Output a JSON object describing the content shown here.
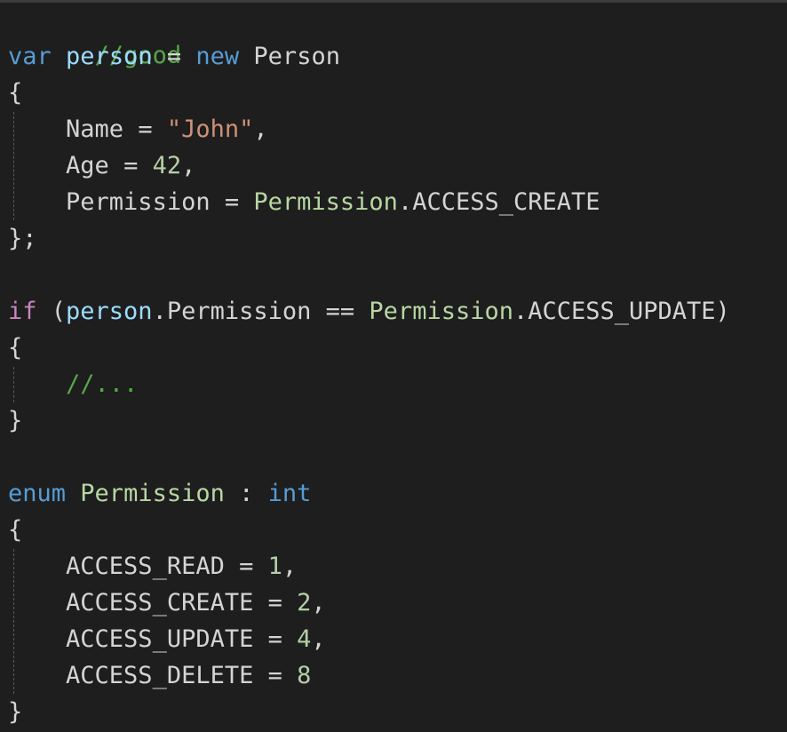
{
  "colors": {
    "background": "#1e1e1e",
    "keyword": "#569cd6",
    "control_keyword": "#c586c0",
    "variable": "#9cdcfe",
    "type": "#b8d7a3",
    "string": "#ce9178",
    "number": "#b5cea8",
    "comment": "#57a64a",
    "text": "#d4d4d4"
  },
  "code": {
    "l1": {
      "comment": "//good"
    },
    "l2": {
      "kw_var": "var",
      "name": "person",
      "op": " = ",
      "kw_new": "new",
      "type": "Person"
    },
    "l3": {
      "brace": "{"
    },
    "l4": {
      "prop": "Name",
      "op": " = ",
      "str": "\"John\"",
      "punct": ","
    },
    "l5": {
      "prop": "Age",
      "op": " = ",
      "num": "42",
      "punct": ","
    },
    "l6": {
      "prop": "Permission",
      "op": " = ",
      "type": "Permission",
      "member": ".ACCESS_CREATE"
    },
    "l7": {
      "brace": "};"
    },
    "l9": {
      "kw_if": "if",
      "open": " (",
      "var": "person",
      "member": ".Permission",
      "op": " == ",
      "type": "Permission",
      "member2": ".ACCESS_UPDATE)"
    },
    "l10": {
      "brace": "{"
    },
    "l11": {
      "comment": "//..."
    },
    "l12": {
      "brace": "}"
    },
    "l14": {
      "kw_enum": "enum",
      "type": "Permission",
      "op": " : ",
      "kw_int": "int"
    },
    "l15": {
      "brace": "{"
    },
    "l16": {
      "name": "ACCESS_READ",
      "op": " = ",
      "num": "1",
      "punct": ","
    },
    "l17": {
      "name": "ACCESS_CREATE",
      "op": " = ",
      "num": "2",
      "punct": ","
    },
    "l18": {
      "name": "ACCESS_UPDATE",
      "op": " = ",
      "num": "4",
      "punct": ","
    },
    "l19": {
      "name": "ACCESS_DELETE",
      "op": " = ",
      "num": "8"
    },
    "l20": {
      "brace": "}"
    }
  }
}
